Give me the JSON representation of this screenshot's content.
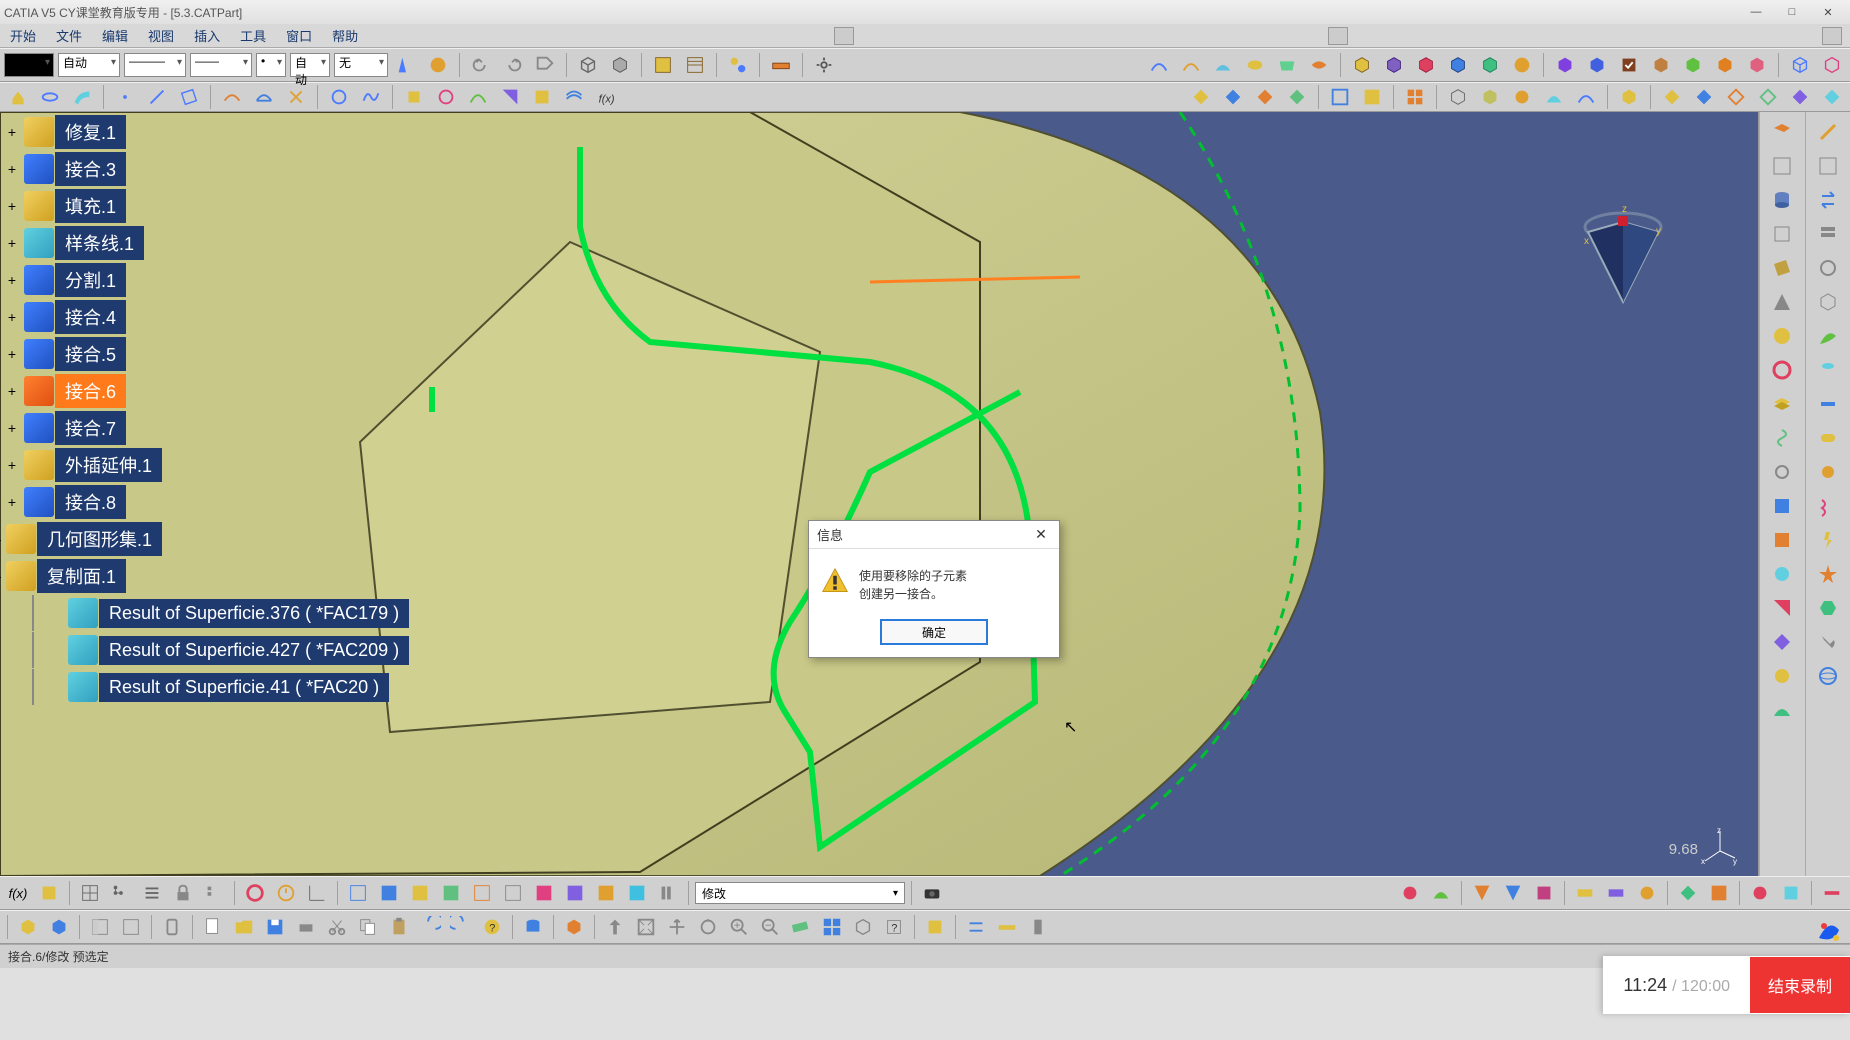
{
  "title": "CATIA V5 CY课堂教育版专用 - [5.3.CATPart]",
  "menu": {
    "start": "开始",
    "file": "文件",
    "edit": "编辑",
    "view": "视图",
    "insert": "插入",
    "tools": "工具",
    "window": "窗口",
    "help": "帮助"
  },
  "toolbar_top": {
    "auto": "自动",
    "auto2": "自动",
    "wu": "无"
  },
  "tree": {
    "items": [
      {
        "label": "修复.1",
        "icon": "yellow"
      },
      {
        "label": "接合.3",
        "icon": "blue"
      },
      {
        "label": "填充.1",
        "icon": "yellow"
      },
      {
        "label": "样条线.1",
        "icon": "cyan"
      },
      {
        "label": "分割.1",
        "icon": "blue"
      },
      {
        "label": "接合.4",
        "icon": "blue"
      },
      {
        "label": "接合.5",
        "icon": "blue"
      },
      {
        "label": "接合.6",
        "icon": "orange",
        "selected": true
      },
      {
        "label": "接合.7",
        "icon": "blue"
      },
      {
        "label": "外插延伸.1",
        "icon": "yellow"
      },
      {
        "label": "接合.8",
        "icon": "blue"
      }
    ],
    "geo_set": "几何图形集.1",
    "copy_face": "复制面.1",
    "results": [
      "Result of Superficie.376 ( *FAC179 )",
      "Result of Superficie.427 ( *FAC209 )",
      "Result of Superficie.41 ( *FAC20 )"
    ]
  },
  "dialog": {
    "title": "信息",
    "line1": "使用要移除的子元素",
    "line2": "创建另一接合。",
    "ok": "确定"
  },
  "bottom_dd": "修改",
  "status": "接合.6/修改 预选定",
  "zoom": "9.68",
  "rec": {
    "cur": "11:24",
    "total": "120:00",
    "stop": "结束录制"
  },
  "axes": {
    "x": "x",
    "y": "y",
    "z": "z"
  }
}
